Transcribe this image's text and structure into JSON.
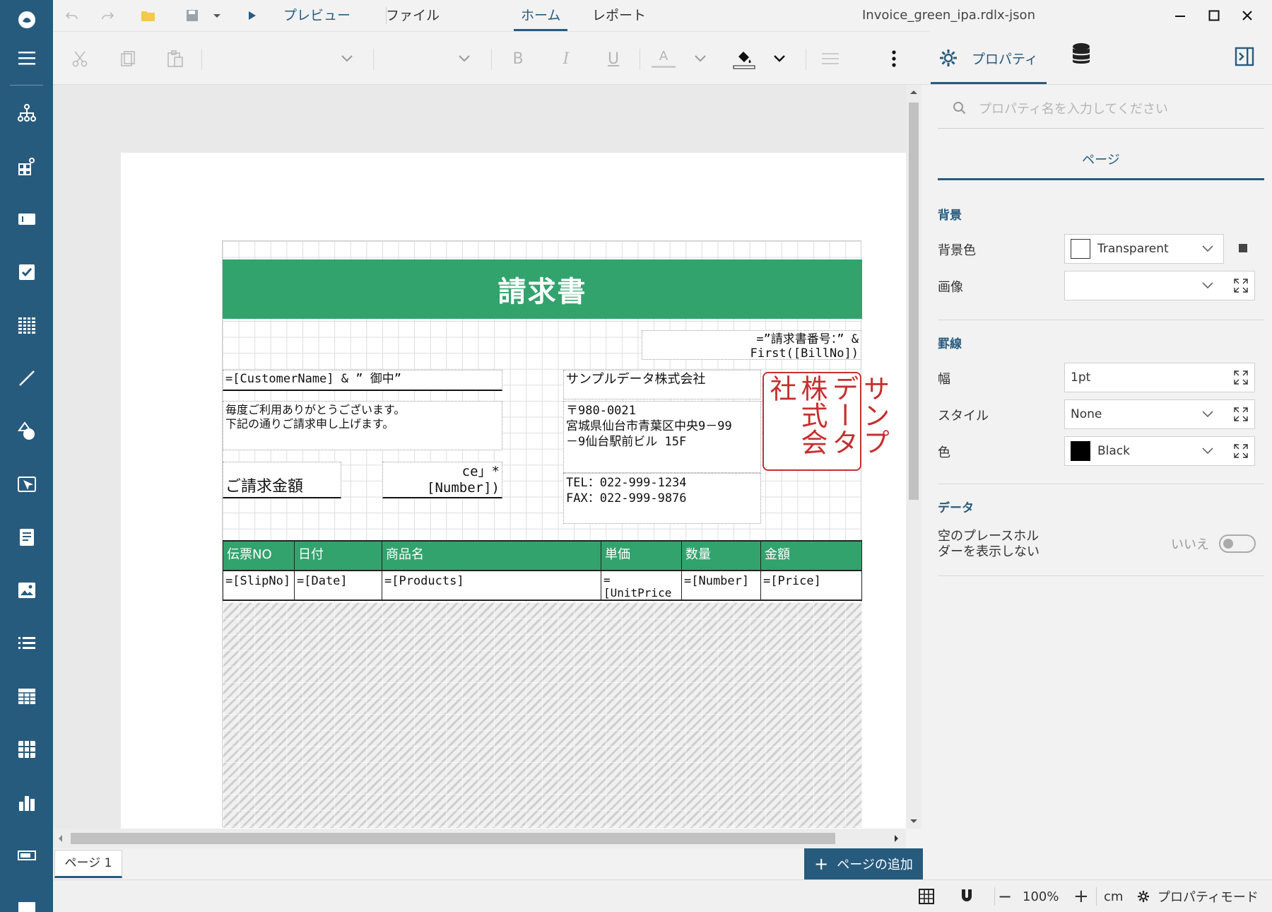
{
  "titlebar": {
    "preview_label": "プレビュー",
    "menu": {
      "file": "ファイル",
      "home": "ホーム",
      "report": "レポート"
    },
    "filename": "Invoice_green_ipa.rdlx-json"
  },
  "toolbar": {
    "bold": "B",
    "italic": "I",
    "underline": "U",
    "font_color_glyph": "A"
  },
  "report": {
    "title": "請求書",
    "bill_no_expr_1": "=”請求書番号：” &",
    "bill_no_expr_2": "First([BillNo])",
    "customer_expr": "=[CustomerName] & ” 御中”",
    "greeting_1": "毎度ご利用ありがとうございます。",
    "greeting_2": "下記の通りご請求申し上げます。",
    "amount_label": "ご請求金額",
    "amount_expr_1": "ce」*",
    "amount_expr_2": "[Number])",
    "company_name": "サンプルデータ株式会社",
    "postal": "〒980-0021",
    "address_1": "宮城県仙台市青葉区中央9－99",
    "address_2": "－9仙台駅前ビル 15F",
    "tel": "TEL：022-999-1234",
    "fax": "FAX：022-999-9876",
    "stamp_columns": [
      "サンプ",
      "データ",
      "株式会社"
    ],
    "table_headers": [
      "伝票NO",
      "日付",
      "商品名",
      "単価",
      "数量",
      "金額"
    ],
    "table_cells": [
      "=[SlipNo]",
      "=[Date]",
      "=[Products]",
      "=",
      "[UnitPrice",
      "=[Number]",
      "=[Price]"
    ]
  },
  "panel": {
    "tab_properties": "プロパティ",
    "search_placeholder": "プロパティ名を入力してください",
    "page_tab": "ページ",
    "section_background": "背景",
    "bg_color_label": "背景色",
    "bg_color_value": "Transparent",
    "image_label": "画像",
    "section_border": "罫線",
    "width_label": "幅",
    "width_value": "1pt",
    "style_label": "スタイル",
    "style_value": "None",
    "color_label": "色",
    "color_value": "Black",
    "section_data": "データ",
    "empty_placeholder_label_1": "空のプレースホル",
    "empty_placeholder_label_2": "ダーを表示しない",
    "toggle_value": "いいえ"
  },
  "pages": {
    "tab_label": "ページ 1",
    "add_page": "ページの追加"
  },
  "status": {
    "zoom": "100%",
    "unit": "cm",
    "property_mode": "プロパティモード"
  },
  "colors": {
    "sidebar": "#275b7e",
    "accent": "#275b7e",
    "report_green": "#33a36e",
    "stamp_red": "#c62f2f"
  }
}
